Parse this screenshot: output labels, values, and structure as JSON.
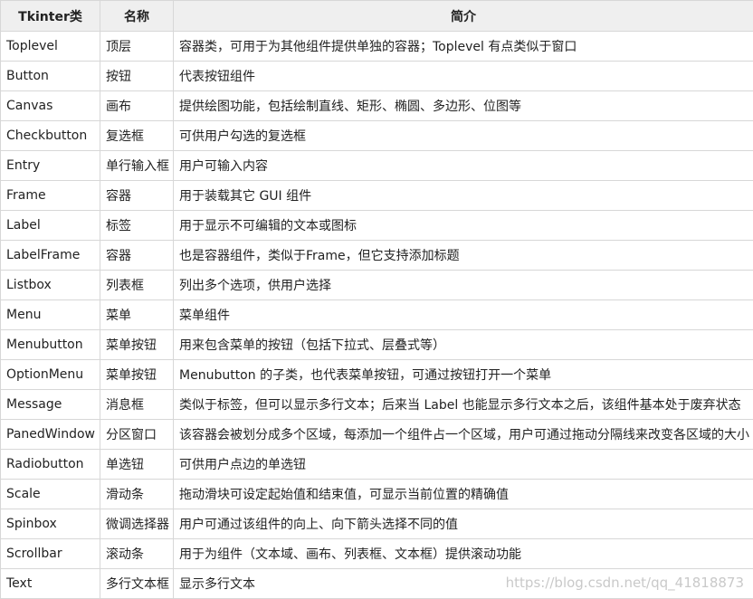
{
  "headers": [
    "Tkinter类",
    "名称",
    "简介"
  ],
  "rows": [
    {
      "cls": "Toplevel",
      "name": "顶层",
      "desc": "容器类，可用于为其他组件提供单独的容器；Toplevel 有点类似于窗口"
    },
    {
      "cls": "Button",
      "name": "按钮",
      "desc": "代表按钮组件"
    },
    {
      "cls": "Canvas",
      "name": "画布",
      "desc": "提供绘图功能，包括绘制直线、矩形、椭圆、多边形、位图等"
    },
    {
      "cls": "Checkbutton",
      "name": "复选框",
      "desc": "可供用户勾选的复选框"
    },
    {
      "cls": "Entry",
      "name": "单行输入框",
      "desc": "用户可输入内容"
    },
    {
      "cls": "Frame",
      "name": "容器",
      "desc": "用于装载其它 GUI 组件"
    },
    {
      "cls": "Label",
      "name": "标签",
      "desc": "用于显示不可编辑的文本或图标"
    },
    {
      "cls": "LabelFrame",
      "name": "容器",
      "desc": "也是容器组件，类似于Frame，但它支持添加标题"
    },
    {
      "cls": "Listbox",
      "name": "列表框",
      "desc": "列出多个选项，供用户选择"
    },
    {
      "cls": "Menu",
      "name": "菜单",
      "desc": "菜单组件"
    },
    {
      "cls": "Menubutton",
      "name": "菜单按钮",
      "desc": "用来包含菜单的按钮（包括下拉式、层叠式等）"
    },
    {
      "cls": "OptionMenu",
      "name": "菜单按钮",
      "desc": "Menubutton 的子类，也代表菜单按钮，可通过按钮打开一个菜单"
    },
    {
      "cls": "Message",
      "name": "消息框",
      "desc": "类似于标签，但可以显示多行文本；后来当 Label 也能显示多行文本之后，该组件基本处于废弃状态"
    },
    {
      "cls": "PanedWindow",
      "name": "分区窗口",
      "desc": "该容器会被划分成多个区域，每添加一个组件占一个区域，用户可通过拖动分隔线来改变各区域的大小"
    },
    {
      "cls": "Radiobutton",
      "name": "单选钮",
      "desc": "可供用户点边的单选钮"
    },
    {
      "cls": "Scale",
      "name": "滑动条",
      "desc": "拖动滑块可设定起始值和结束值，可显示当前位置的精确值"
    },
    {
      "cls": "Spinbox",
      "name": "微调选择器",
      "desc": "用户可通过该组件的向上、向下箭头选择不同的值"
    },
    {
      "cls": "Scrollbar",
      "name": "滚动条",
      "desc": "用于为组件（文本域、画布、列表框、文本框）提供滚动功能"
    },
    {
      "cls": "Text",
      "name": "多行文本框",
      "desc": "显示多行文本"
    }
  ],
  "watermark": "https://blog.csdn.net/qq_41818873"
}
